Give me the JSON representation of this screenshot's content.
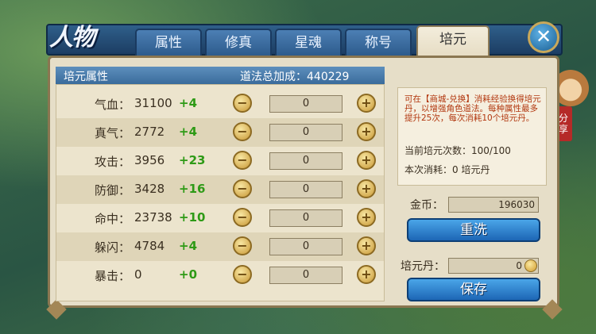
{
  "header": {
    "title": "人物",
    "tabs": [
      {
        "label": "属性",
        "active": false
      },
      {
        "label": "修真",
        "active": false
      },
      {
        "label": "星魂",
        "active": false
      },
      {
        "label": "称号",
        "active": false
      },
      {
        "label": "培元",
        "active": true
      }
    ],
    "close_icon": "close-x-icon"
  },
  "section": {
    "title": "培元属性",
    "total_label": "道法总加成：440229"
  },
  "stats": [
    {
      "label": "气血：",
      "value": "31100",
      "bonus": "+4",
      "amount": "0"
    },
    {
      "label": "真气：",
      "value": "2772",
      "bonus": "+4",
      "amount": "0"
    },
    {
      "label": "攻击：",
      "value": "3956",
      "bonus": "+23",
      "amount": "0"
    },
    {
      "label": "防御：",
      "value": "3428",
      "bonus": "+16",
      "amount": "0"
    },
    {
      "label": "命中：",
      "value": "23738",
      "bonus": "+10",
      "amount": "0"
    },
    {
      "label": "躲闪：",
      "value": "4784",
      "bonus": "+4",
      "amount": "0"
    },
    {
      "label": "暴击：",
      "value": "0",
      "bonus": "+0",
      "amount": "0"
    }
  ],
  "info": {
    "description": "可在【商城-兑换】消耗经验换得培元丹，以增强角色道法。每种属性最多提升25次，每次消耗10个培元丹。",
    "count_line": "当前培元次数：100/100",
    "cost_line": "本次消耗：0 培元丹"
  },
  "gold": {
    "label": "金币：",
    "value": "196030"
  },
  "reset_button": "重洗",
  "pill": {
    "label": "培元丹：",
    "value": "0"
  },
  "save_button": "保存",
  "share": {
    "label": "分享"
  },
  "colors": {
    "accent_blue": "#2d6fb8",
    "panel": "#e6dec8",
    "bonus_green": "#2e9a16",
    "desc_red": "#b2370f"
  }
}
